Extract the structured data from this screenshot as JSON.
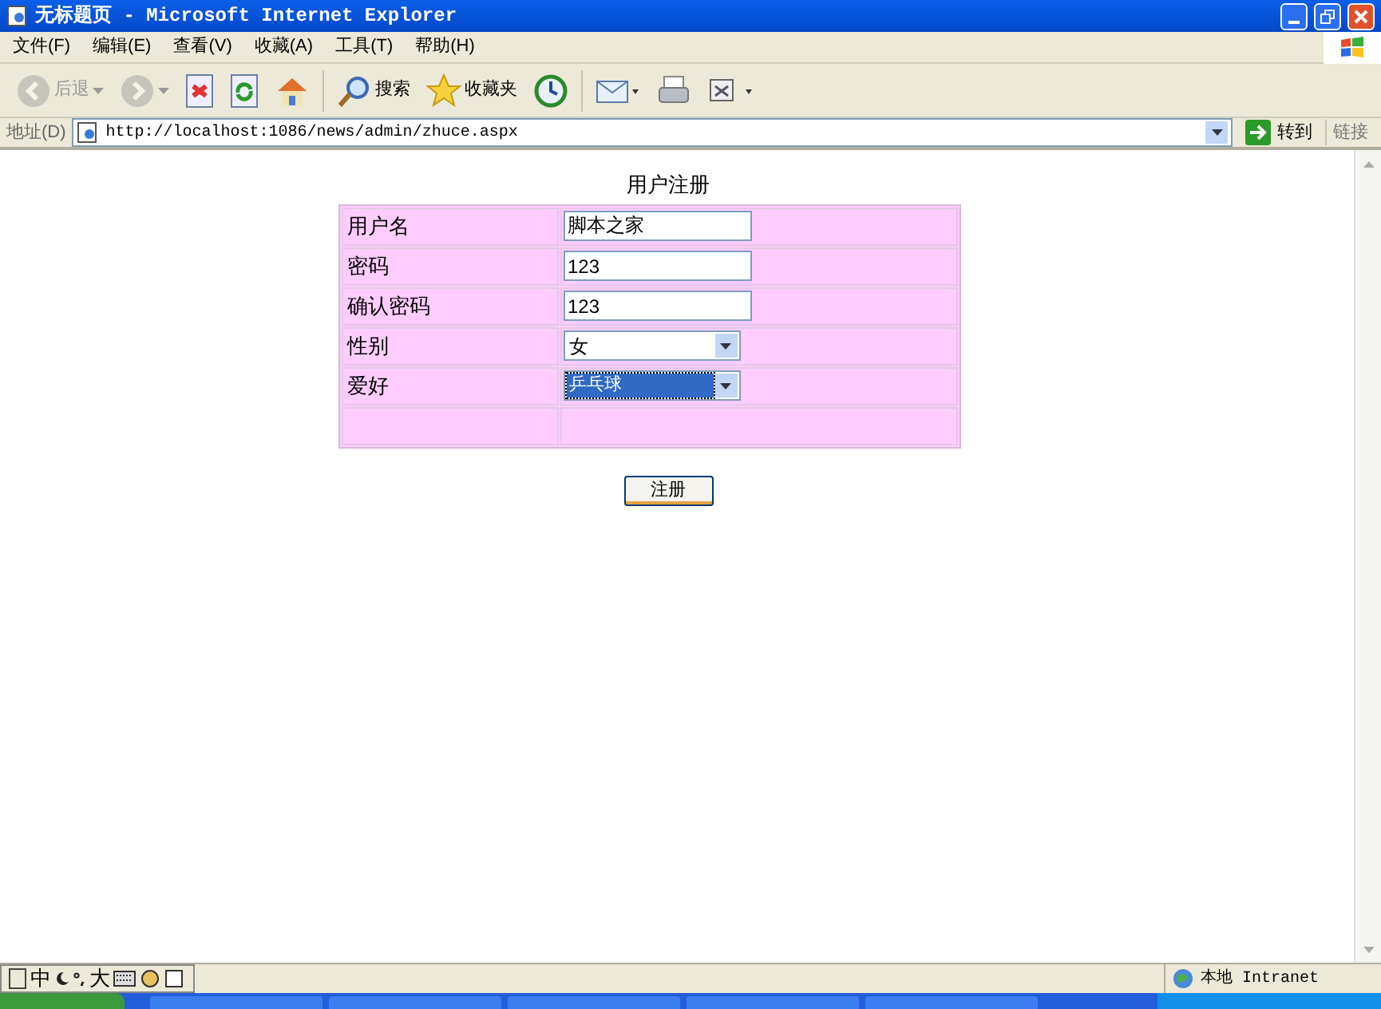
{
  "window": {
    "title": "无标题页 - Microsoft Internet Explorer"
  },
  "menu": [
    "文件(F)",
    "编辑(E)",
    "查看(V)",
    "收藏(A)",
    "工具(T)",
    "帮助(H)"
  ],
  "toolbar": [
    {
      "kind": "back",
      "label": "后退",
      "disabled": true
    },
    {
      "kind": "forward",
      "disabled": true
    },
    {
      "kind": "stop"
    },
    {
      "kind": "refresh"
    },
    {
      "kind": "home"
    },
    {
      "kind": "search",
      "label": "搜索"
    },
    {
      "kind": "favorites",
      "label": "收藏夹"
    },
    {
      "kind": "history"
    },
    {
      "kind": "mail"
    },
    {
      "kind": "print"
    },
    {
      "kind": "edit"
    }
  ],
  "address": {
    "label": "地址(D)",
    "url": "http://localhost:1086/news/admin/zhuce.aspx",
    "go": "转到",
    "links": "链接"
  },
  "page": {
    "heading": "用户注册",
    "rows": [
      {
        "label": "用户名",
        "kind": "text",
        "value": "脚本之家"
      },
      {
        "label": "密码",
        "kind": "text",
        "value": "123"
      },
      {
        "label": "确认密码",
        "kind": "text",
        "value": "123"
      },
      {
        "label": "性别",
        "kind": "select",
        "value": "女",
        "focused": false
      },
      {
        "label": "爱好",
        "kind": "select",
        "value": "乒乓球",
        "focused": true
      },
      {
        "kind": "empty"
      }
    ],
    "submit": "注册"
  },
  "ime": {
    "mode": "中",
    "width": "大"
  },
  "status_bar": {
    "zone": "本地 Intranet"
  }
}
